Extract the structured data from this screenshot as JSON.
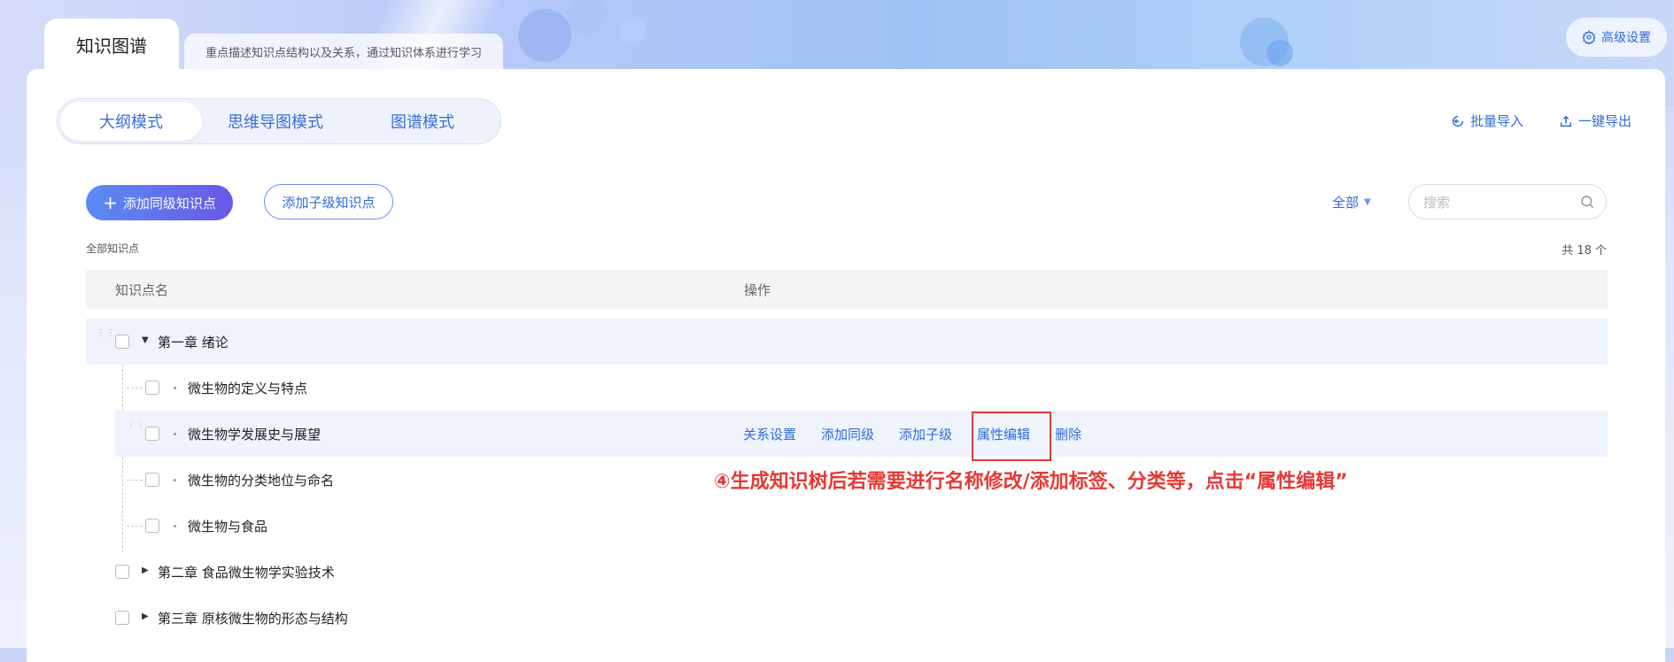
{
  "tabs": {
    "active_label": "知识图谱",
    "description": "重点描述知识点结构以及关系，通过知识体系进行学习"
  },
  "advanced_settings_label": "高级设置",
  "modes": [
    "大纲模式",
    "思维导图模式",
    "图谱模式"
  ],
  "top_actions": {
    "batch_import": "批量导入",
    "export": "一键导出"
  },
  "toolbar": {
    "add_sibling": "添加同级知识点",
    "add_child": "添加子级知识点",
    "filter_value": "全部",
    "search_placeholder": "搜索"
  },
  "summary": {
    "all_label": "全部知识点",
    "count": "共 18 个"
  },
  "table": {
    "col_name": "知识点名",
    "col_ops": "操作"
  },
  "rows": [
    {
      "label": "第一章 绪论"
    },
    {
      "label": "微生物的定义与特点"
    },
    {
      "label": "微生物学发展史与展望"
    },
    {
      "label": "微生物的分类地位与命名"
    },
    {
      "label": "微生物与食品"
    },
    {
      "label": "第二章 食品微生物学实验技术"
    },
    {
      "label": "第三章 原核微生物的形态与结构"
    }
  ],
  "row_ops": [
    "关系设置",
    "添加同级",
    "添加子级",
    "属性编辑",
    "删除"
  ],
  "annotation": "④生成知识树后若需要进行名称修改/添加标签、分类等，点击“属性编辑”",
  "colors": {
    "accent": "#2f6bde",
    "highlight": "#e53935"
  }
}
